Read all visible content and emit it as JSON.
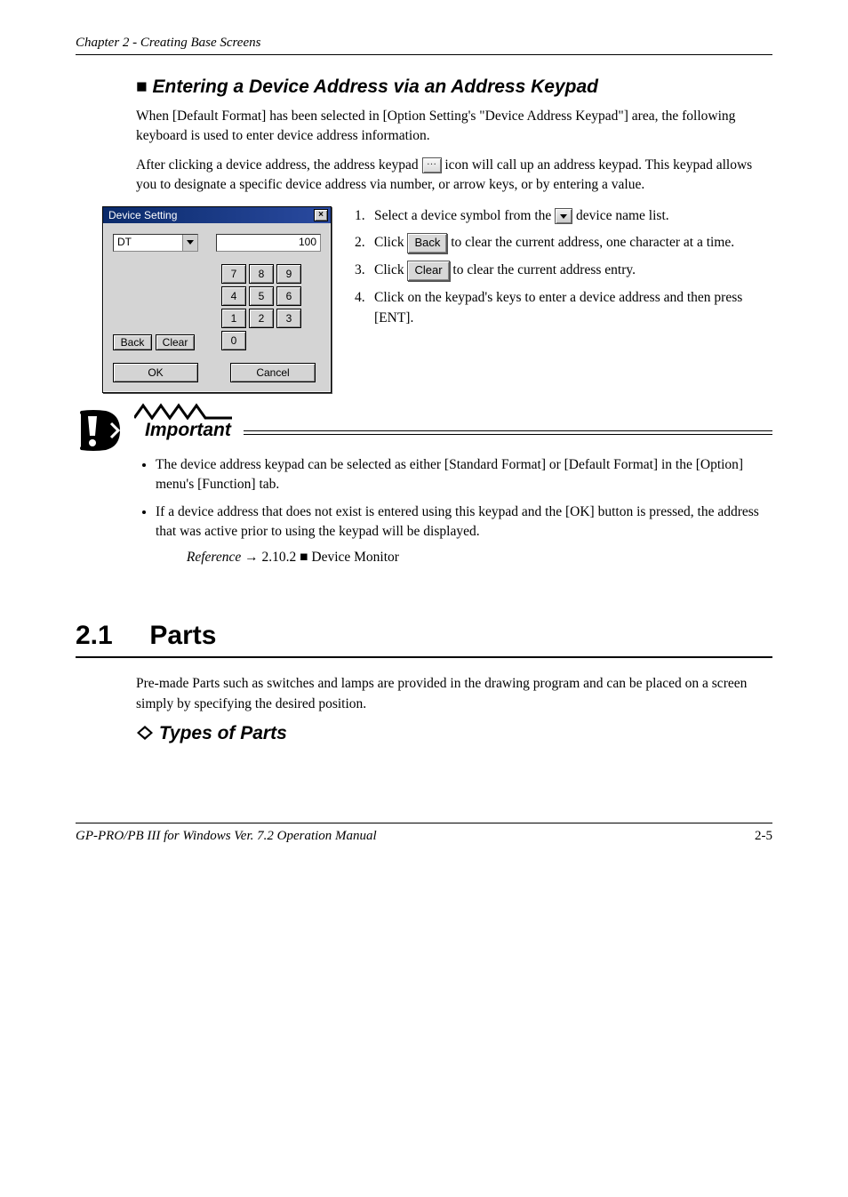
{
  "chapter_header": "Chapter 2 - Creating Base Screens",
  "section_heading": "■ Entering a Device Address via an Address Keypad",
  "intro_para_1": "When [Default Format] has been selected in [Option Setting's \"Device Address Keypad\"] area, the following keyboard is used to enter device address information.",
  "intro_para_2_a": "After clicking a device address, the address keypad ",
  "intro_para_2_b": " icon will call up an address keypad. This keypad allows you to designate a specific device address via number, or arrow keys, or by entering a value.",
  "instr": [
    {
      "num": "1.",
      "text_a": "Select a device symbol from the ",
      "text_b": " device name list."
    },
    {
      "num": "2.",
      "text_a": "Click ",
      "btn": "Back",
      "text_b": " to clear the current address, one character at a time."
    },
    {
      "num": "3.",
      "text": null,
      "text_a": "Click ",
      "btn": "Clear",
      "text_b": " to clear the current address entry."
    },
    {
      "num": "4.",
      "text": "Click on the keypad's keys to enter a device address and then press [ENT]."
    }
  ],
  "dialog": {
    "title": "Device Setting",
    "combo_value": "DT",
    "number_value": "100",
    "keys": [
      "7",
      "8",
      "9",
      "4",
      "5",
      "6",
      "1",
      "2",
      "3",
      "0"
    ],
    "back_label": "Back",
    "clear_label": "Clear",
    "ok_label": "OK",
    "cancel_label": "Cancel"
  },
  "important_label": "Important",
  "bullet1": "The device address keypad can be selected as either [Standard Format] or [Default Format] in the [Option] menu's [Function] tab.",
  "bullet2_a": "If a device address that does not exist is entered using this keypad and the [OK] button is pressed, the address that was active prior to using the keypad will be displayed.",
  "see_ref": "2.10.2 ■ Device Monitor",
  "big_heading_num": "2.1",
  "big_heading_text": "Parts",
  "parts_para": "Pre-made Parts such as switches and lamps are provided in the drawing program and can be placed on a screen simply by specifying the desired position.",
  "subhead": " Types of Parts",
  "footer_left": "GP-PRO/PB III for Windows Ver. 7.2 Operation Manual",
  "footer_right": "2-5"
}
